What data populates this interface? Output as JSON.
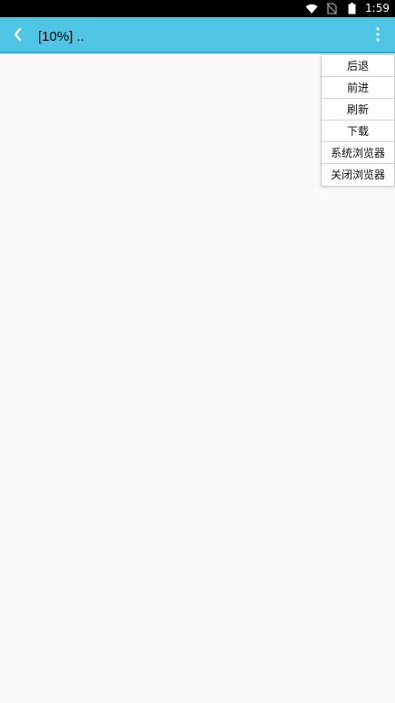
{
  "status_bar": {
    "time": "1:59",
    "icons": [
      "wifi-icon",
      "no-sim-icon",
      "battery-icon"
    ]
  },
  "app_bar": {
    "title": "[10%] ..",
    "back_icon": "chevron-left-icon",
    "overflow_icon": "more-vertical-icon",
    "background_color": "#4ec5e4"
  },
  "menu": {
    "items": [
      {
        "label": "后退"
      },
      {
        "label": "前进"
      },
      {
        "label": "刷新"
      },
      {
        "label": "下载"
      },
      {
        "label": "系统浏览器"
      },
      {
        "label": "关闭浏览器"
      }
    ]
  }
}
